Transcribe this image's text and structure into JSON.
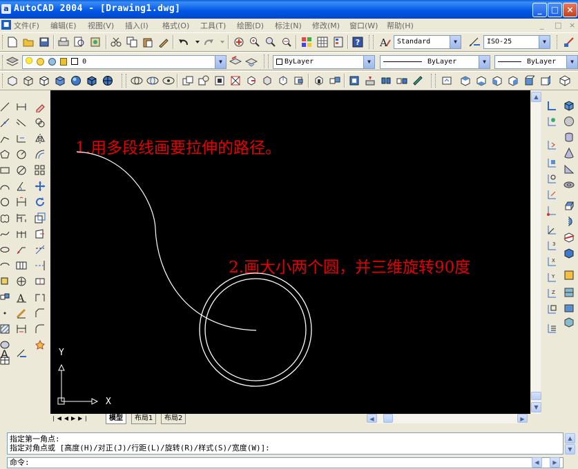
{
  "window": {
    "app_icon": "a",
    "title": "AutoCAD 2004 - [Drawing1.dwg]",
    "controls": {
      "minimize": "_",
      "maximize": "□",
      "close": "×"
    }
  },
  "menu": {
    "doc_icon": "■",
    "items": [
      "文件(F)",
      "编辑(E)",
      "视图(V)",
      "插入(I)",
      "格式(O)",
      "工具(T)",
      "绘图(D)",
      "标注(N)",
      "修改(M)",
      "窗口(W)",
      "帮助(H)"
    ],
    "mdi_controls": [
      "_",
      "□",
      "×"
    ]
  },
  "standard_toolbar": {
    "text_style": "Standard",
    "dim_style": "ISO-25"
  },
  "layers_toolbar": {
    "current_layer": "0"
  },
  "properties_toolbar": {
    "color": "ByLayer",
    "linetype": "ByLayer",
    "lineweight": "ByLayer"
  },
  "annotations": {
    "step1": "1.用多段线画要拉伸的路径。",
    "step2": "2.画大小两个圆，并三维旋转90度"
  },
  "ucs": {
    "x_label": "X",
    "y_label": "Y"
  },
  "tabs": {
    "model": "模型",
    "layout1": "布局1",
    "layout2": "布局2"
  },
  "command": {
    "history": [
      "指定第一角点:",
      "指定对角点或 [高度(H)/对正(J)/行距(L)/旋转(R)/样式(S)/宽度(W)]:"
    ],
    "prompt": "命令:"
  },
  "colors": {
    "annotation": "#e30000",
    "canvas": "#000000",
    "entity": "#ffffff",
    "titlebar": "#0055e5"
  }
}
